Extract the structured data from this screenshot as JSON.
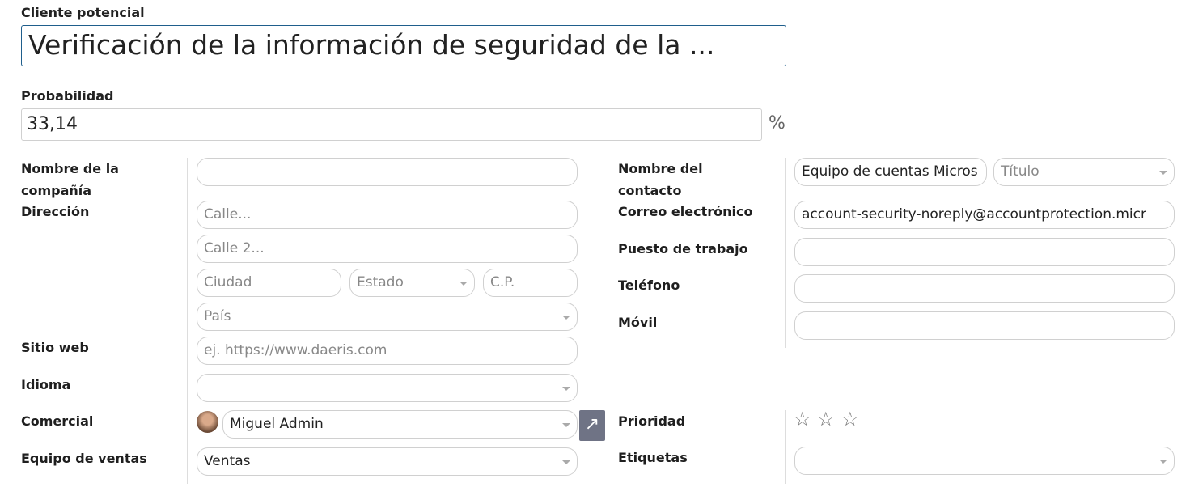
{
  "lead": {
    "label": "Cliente potencial",
    "title": "Verificación de la información de seguridad de la ..."
  },
  "probability": {
    "label": "Probabilidad",
    "value": "33,14",
    "unit": "%"
  },
  "left": {
    "company_label": "Nombre de la compañía",
    "company_value": "",
    "address_label": "Dirección",
    "street_ph": "Calle...",
    "street2_ph": "Calle 2...",
    "city_ph": "Ciudad",
    "state_ph": "Estado",
    "zip_ph": "C.P.",
    "country_ph": "País",
    "website_label": "Sitio web",
    "website_ph": "ej. https://www.daeris.com",
    "language_label": "Idioma",
    "salesperson_label": "Comercial",
    "salesperson_value": "Miguel Admin",
    "team_label": "Equipo de ventas",
    "team_value": "Ventas"
  },
  "right": {
    "contact_label": "Nombre del contacto",
    "contact_value": "Equipo de cuentas Micros",
    "title_ph": "Título",
    "email_label": "Correo electrónico",
    "email_value": "account-security-noreply@accountprotection.micr",
    "job_label": "Puesto de trabajo",
    "phone_label": "Teléfono",
    "mobile_label": "Móvil",
    "priority_label": "Prioridad",
    "priority_stars": 0,
    "priority_max": 3,
    "tags_label": "Etiquetas"
  },
  "colors": {
    "accent": "#1f5e8c",
    "external_button": "#6f7385"
  }
}
